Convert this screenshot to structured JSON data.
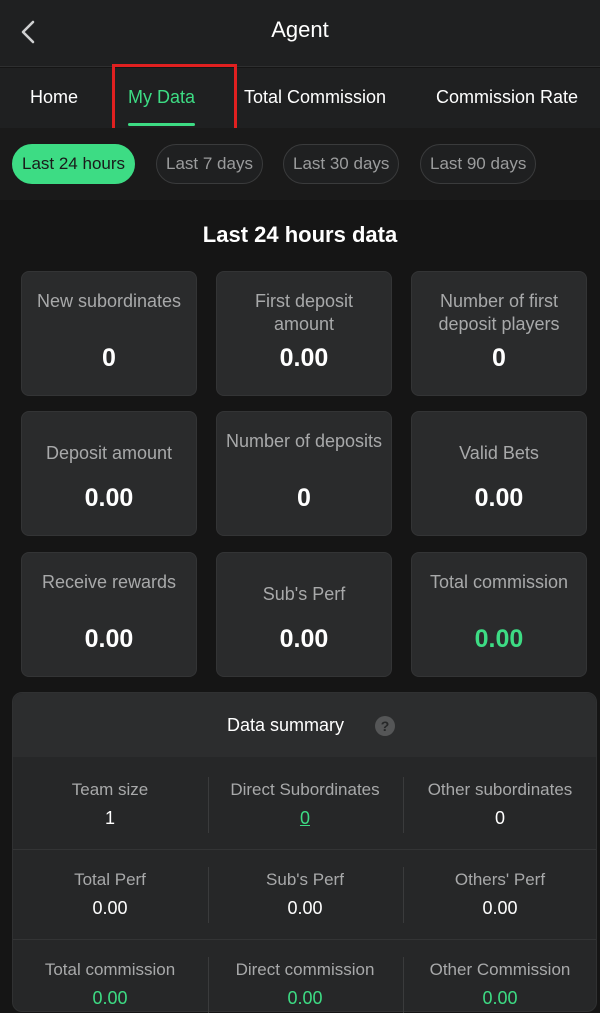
{
  "header": {
    "title": "Agent",
    "back_icon": "chevron-left-icon"
  },
  "tabs": [
    {
      "label": "Home"
    },
    {
      "label": "My Data"
    },
    {
      "label": "Total Commission"
    },
    {
      "label": "Commission Rate"
    }
  ],
  "filters": [
    {
      "label": "Last 24 hours"
    },
    {
      "label": "Last 7 days"
    },
    {
      "label": "Last 30 days"
    },
    {
      "label": "Last 90 days"
    }
  ],
  "section_title": "Last 24 hours data",
  "cards": [
    {
      "label": "New subordinates",
      "value": "0"
    },
    {
      "label": "First deposit amount",
      "value": "0.00"
    },
    {
      "label": "Number of first deposit players",
      "value": "0"
    },
    {
      "label": "Deposit amount",
      "value": "0.00"
    },
    {
      "label": "Number of deposits",
      "value": "0"
    },
    {
      "label": "Valid Bets",
      "value": "0.00"
    },
    {
      "label": "Receive rewards",
      "value": "0.00"
    },
    {
      "label": "Sub's Perf",
      "value": "0.00"
    },
    {
      "label": "Total commission",
      "value": "0.00"
    }
  ],
  "summary": {
    "title": "Data summary",
    "help_icon": "?",
    "rows": [
      [
        {
          "label": "Team size",
          "value": "1"
        },
        {
          "label": "Direct Subordinates",
          "value": "0"
        },
        {
          "label": "Other subordinates",
          "value": "0"
        }
      ],
      [
        {
          "label": "Total Perf",
          "value": "0.00"
        },
        {
          "label": "Sub's Perf",
          "value": "0.00"
        },
        {
          "label": "Others' Perf",
          "value": "0.00"
        }
      ],
      [
        {
          "label": "Total commission",
          "value": "0.00"
        },
        {
          "label": "Direct commission",
          "value": "0.00"
        },
        {
          "label": "Other Commission",
          "value": "0.00"
        }
      ]
    ]
  },
  "colors": {
    "accent": "#3ddc84",
    "highlight": "#e02020",
    "background": "#151515"
  }
}
